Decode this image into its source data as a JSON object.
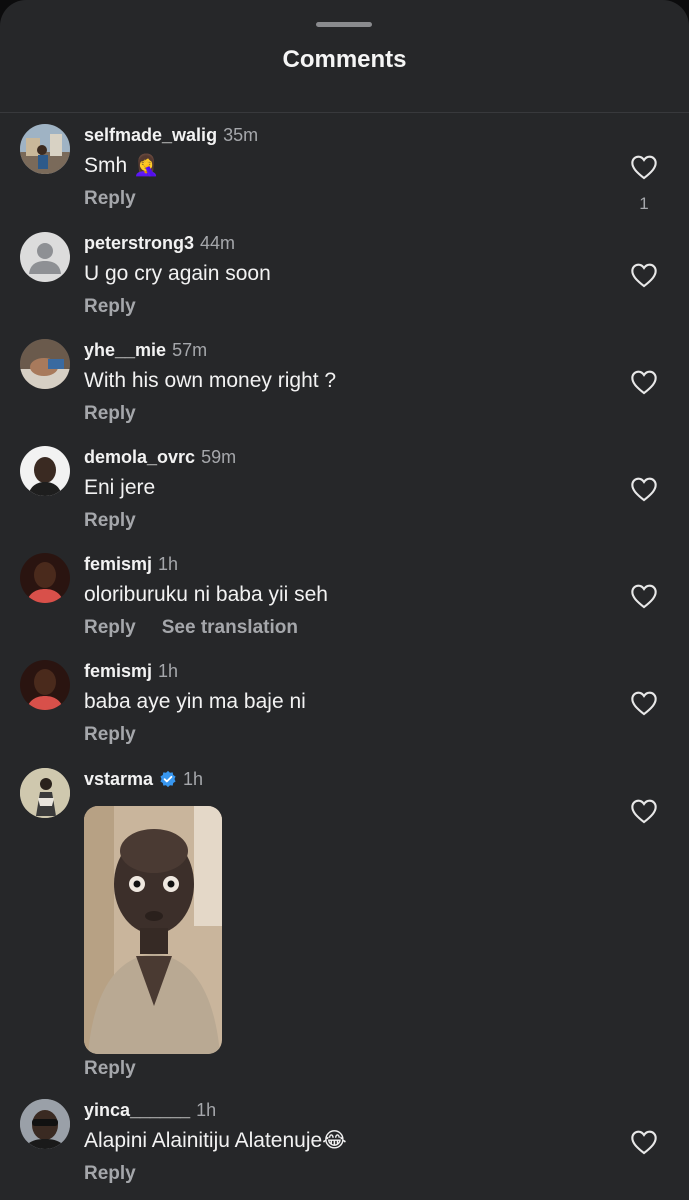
{
  "header": {
    "title": "Comments"
  },
  "reply_label": "Reply",
  "comments": [
    {
      "username": "selfmade_walig",
      "time": "35m",
      "text": "Smh 🤦‍♀️",
      "likes": "1",
      "avatar": "photo-street"
    },
    {
      "username": "peterstrong3",
      "time": "44m",
      "text": "U go cry again soon",
      "avatar": "default-person-icon"
    },
    {
      "username": "yhe__mie",
      "time": "57m",
      "text": "With his own money right ?",
      "avatar": "photo-hand"
    },
    {
      "username": "demola_ovrc",
      "time": "59m",
      "text": "Eni jere",
      "avatar": "photo-face"
    },
    {
      "username": "femismj",
      "time": "1h",
      "text": "oloriburuku ni baba yii seh",
      "extra_action": "See translation",
      "avatar": "photo-face-red"
    },
    {
      "username": "femismj",
      "time": "1h",
      "text": "baba aye yin ma baje ni",
      "avatar": "photo-face-red"
    },
    {
      "username": "vstarma",
      "time": "1h",
      "verified": true,
      "text": "",
      "media": "gif-staring-man",
      "avatar": "photo-figure"
    },
    {
      "username": "yinca______",
      "time": "1h",
      "text": "Alapini Alainitiju Alatenuje😂",
      "avatar": "photo-sunglasses"
    }
  ],
  "colors": {
    "background": "#262729",
    "secondary_text": "#a5a7ab",
    "verified": "#3897f0"
  }
}
